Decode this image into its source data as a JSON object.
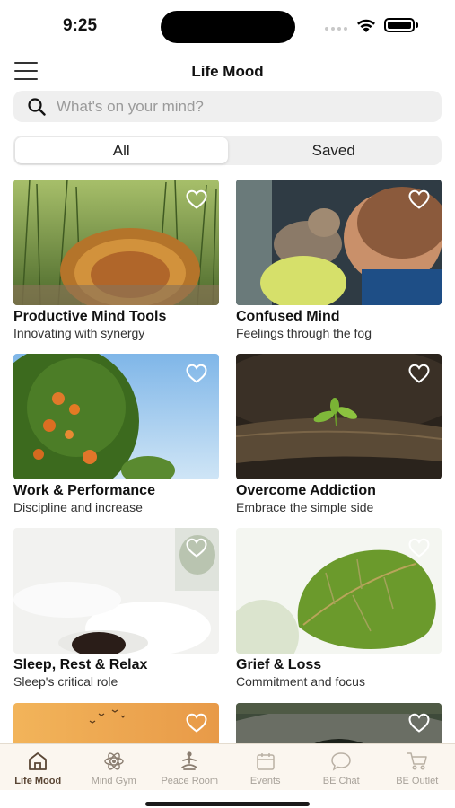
{
  "status": {
    "time": "9:25"
  },
  "header": {
    "title": "Life Mood"
  },
  "search": {
    "placeholder": "What's on your mind?"
  },
  "segments": {
    "all": "All",
    "saved": "Saved",
    "active": "All"
  },
  "cards": [
    {
      "title": "Productive Mind Tools",
      "subtitle": "Innovating with synergy",
      "image": "peacock-in-grass"
    },
    {
      "title": "Confused Mind",
      "subtitle": "Feelings through the fog",
      "image": "child-kissing-kitten"
    },
    {
      "title": "Work & Performance",
      "subtitle": "Discipline and increase",
      "image": "orange-tree"
    },
    {
      "title": "Overcome Addiction",
      "subtitle": "Embrace the simple side",
      "image": "sprout-on-log"
    },
    {
      "title": "Sleep, Rest & Relax",
      "subtitle": "Sleep's critical role",
      "image": "person-sleeping"
    },
    {
      "title": "Grief & Loss",
      "subtitle": "Commitment and focus",
      "image": "green-leaf"
    },
    {
      "title": "",
      "subtitle": "",
      "image": "birds-at-sunset"
    },
    {
      "title": "",
      "subtitle": "",
      "image": "stone-bridge"
    }
  ],
  "tabs": [
    {
      "label": "Life Mood",
      "icon": "home-icon",
      "active": true
    },
    {
      "label": "Mind Gym",
      "icon": "atom-icon",
      "active": false
    },
    {
      "label": "Peace Room",
      "icon": "meditation-icon",
      "active": false
    },
    {
      "label": "Events",
      "icon": "calendar-icon",
      "active": false
    },
    {
      "label": "BE Chat",
      "icon": "chat-icon",
      "active": false
    },
    {
      "label": "BE Outlet",
      "icon": "cart-icon",
      "active": false
    }
  ],
  "colors": {
    "tabbar_bg": "#fbf6ef",
    "tab_active": "#5a4635",
    "tab_inactive": "#a8a29a",
    "search_bg": "#efefef"
  }
}
